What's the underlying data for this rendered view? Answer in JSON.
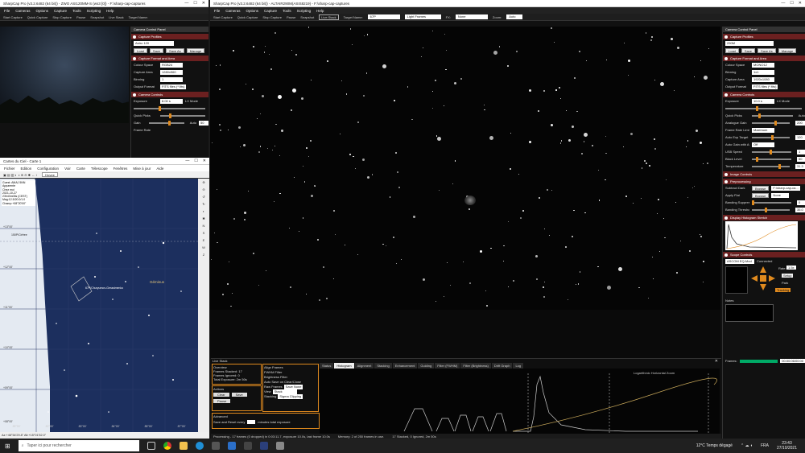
{
  "left_sharpcap": {
    "title": "SharpCap Pro (v3.2.6482 (64 bit)) - ZWO ASI120MM-S (ws3 [0]) - F:\\sharp-cap-captures",
    "menu": [
      "File",
      "Cameras",
      "Options",
      "Capture",
      "Tools",
      "Scripting",
      "Help"
    ],
    "toolbar": [
      "Start Capture",
      "Quick Capture",
      "Stop Capture",
      "Pause",
      "Snapshot",
      "Live Stack",
      "Target Name:"
    ],
    "panel_title": "Camera Control Panel",
    "sections": {
      "profiles": "Capture Profiles",
      "format": "Capture Format and Area",
      "controls": "Camera Controls"
    },
    "profile_value": "Astro 120",
    "buttons": [
      "Load",
      "Save",
      "Save As",
      "Manage"
    ],
    "rows": [
      {
        "label": "Colour Space",
        "value": "RGB24"
      },
      {
        "label": "Capture Area",
        "value": "1280x960"
      },
      {
        "label": "Binning",
        "value": "1"
      },
      {
        "label": "Output Format",
        "value": "FITS files (*.fits)"
      }
    ],
    "exposure_label": "Exposure",
    "exposure_value": "8.00 s",
    "lx_mode": "LX Mode",
    "quick_picks": "Quick Picks",
    "gain": "Gain",
    "auto": "Auto",
    "gain_value": "50",
    "frame_rate": "Frame Rate"
  },
  "cdc": {
    "title": "Cartes du Ciel - Carte 1",
    "menu": [
      "Fichier",
      "Edition",
      "Configuration",
      "Voir",
      "Carte",
      "Télescope",
      "Fenêtres",
      "Mise à jour",
      "Aide"
    ],
    "toolbar_value": "Hovee",
    "info": [
      "Guest: AMAJ 5NN",
      "Apparente",
      "Chez moi",
      "2021-10-27",
      "23h43m06s (CEST)",
      "Mag:12.5/20.0/1.0",
      "Champ:+08°20'00\""
    ],
    "labels": {
      "dec1": "+13°00'",
      "dec2": "+12°00'",
      "dec3": "+11°00'",
      "dec4": "+10°00'",
      "dec5": "+09°00'",
      "dec6": "+08°00'",
      "obj1": "150P/Cirfree",
      "obj2": "67P/Churyumov-Gerasimenko",
      "obj3": "Géminus",
      "ra1": "85°00'",
      "ra2": "82°00'",
      "ra3": "83°00'",
      "ra4": "84°00'",
      "ra5": "85°00'",
      "ra6": "87°00'",
      "coord": "Az:+46°54'29.8\"  Alt:+15°01'52.0\""
    }
  },
  "main": {
    "title": "SharpCap Pro (v3.2.6482 (64 bit)) - ALTAIR290M(ASIS8219) - F:\\sharp-cap-captures",
    "menu": [
      "File",
      "Cameras",
      "Options",
      "Capture",
      "Tools",
      "Scripting",
      "Help"
    ],
    "toolbar": [
      "Start Capture",
      "Quick Capture",
      "Stop Capture",
      "Pause",
      "Snapshot",
      "Live Stack",
      "Target Name:"
    ],
    "target": "67P",
    "frames": "Light Frames",
    "fx_label": "FX:",
    "fx_value": "None",
    "zoom_label": "Zoom:",
    "zoom_value": "Auto",
    "panel_title": "Camera Control Panel",
    "profile_value": "290M",
    "buttons": [
      "Load",
      "Save",
      "Save As",
      "Manage"
    ],
    "sections": [
      "Capture Profiles",
      "Capture Format and Area",
      "Camera Controls",
      "Image Controls",
      "Preprocessing",
      "Display Histogram Stretch",
      "Scope Controls"
    ],
    "rows_format": [
      {
        "label": "Colour Space",
        "value": "MONO12"
      },
      {
        "label": "Binning",
        "value": "1x1"
      },
      {
        "label": "Capture Area",
        "value": "1920x1080"
      },
      {
        "label": "Output Format",
        "value": "FITS files (*.fits)"
      }
    ],
    "exposure_value": "10.0 s",
    "lx_mode": "LX Mode",
    "quick_picks": "Quick Picks",
    "auto": "Auto",
    "controls": [
      {
        "label": "Analogue Gain",
        "value": "200"
      },
      {
        "label": "Frame Rate Limit",
        "value": "Maximum"
      },
      {
        "label": "Auto Exp Target",
        "value": "120"
      },
      {
        "label": "Auto Gain with Auto Exposure",
        "value": "Off"
      },
      {
        "label": "USB Speed",
        "value": "1"
      },
      {
        "label": "Black Level",
        "value": "50"
      },
      {
        "label": "Temperature",
        "value": "31.3"
      }
    ],
    "pre": [
      {
        "label": "Subtract Dark",
        "btn": "Browse",
        "value": "F:\\sharp-cap-ca..."
      },
      {
        "label": "Apply Flat",
        "btn": "Browse",
        "value": "None"
      },
      {
        "label": "Banding Suppression",
        "value": "0"
      },
      {
        "label": "Banding Threshold",
        "value": "35.0"
      }
    ],
    "scope_name": "ASCOM EQ-Mod",
    "connected": "Connected",
    "rate_label": "Rate:",
    "rate_value": "1.5x",
    "setup": "Setup",
    "park": "Park",
    "tracking": "Tracking",
    "notes": "Notes",
    "frames_label": "Frames:",
    "frames_value": "00:00:06/00:00"
  },
  "livestack": {
    "title": "Live Stack",
    "overview": "Overview",
    "stats": [
      "Frames Stacked: 17",
      "Frames Ignored: 0",
      "Total Exposure: 2m 50s"
    ],
    "actions": "Actions",
    "btn_clear": "Clear",
    "btn_save": "Save",
    "btn_pause": "Pause",
    "options": [
      "Align Frames",
      "FWHM Filter",
      "Brightness Filter",
      "Auto Save on Clear/Close"
    ],
    "raw_frames_label": "Raw Frames",
    "raw_frames_value": "Save None",
    "view_label": "View",
    "view_value": "Stack",
    "stacking_label": "Stacking",
    "stacking_value": "Sigma Clipping",
    "advanced": "Advanced",
    "save_reset": "Save and Reset every",
    "minutes": "minutes total exposure",
    "tabs": [
      "Status",
      "Histogram",
      "Alignment",
      "Stacking",
      "Enhancement",
      "Guiding",
      "Filter (FWHM)",
      "Filter (Brightness)",
      "Drift Graph",
      "Log"
    ],
    "log_label": "Logarithmic Horizontal Zoom",
    "status": [
      "Processing - 17 frames (0 dropped) in 0:03:11.7, exposure 10.0s, last frame 10.0s",
      "Memory: 2 of 250 frames in use.",
      "17 Stacked, 0 Ignored, 2m 50s"
    ]
  },
  "taskbar": {
    "search": "Taper ici pour rechercher",
    "weather": "12°C Temps dégagé",
    "lang": "FRA",
    "time": "23:43",
    "date": "27/10/2021"
  },
  "colors": {
    "accent": "#e08a1e",
    "section": "#6b2020",
    "grid": "#2a3a6a"
  }
}
